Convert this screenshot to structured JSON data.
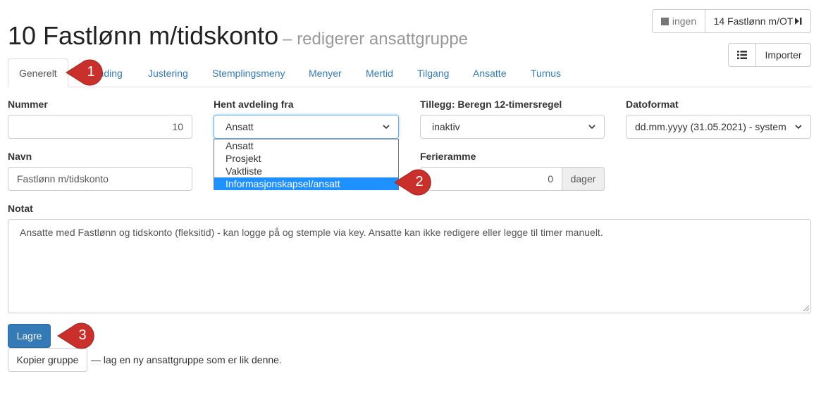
{
  "title": {
    "main": "10 Fastlønn m/tidskonto",
    "sub": "– redigerer ansattgruppe"
  },
  "topnav": {
    "prev_label": "ingen",
    "next_label": "14 Fastlønn m/OT"
  },
  "toolbar": {
    "import_label": "Importer"
  },
  "tabs": [
    {
      "label": "Generelt"
    },
    {
      "label": "Avrunding"
    },
    {
      "label": "Justering"
    },
    {
      "label": "Stemplingsmeny"
    },
    {
      "label": "Menyer"
    },
    {
      "label": "Mertid"
    },
    {
      "label": "Tilgang"
    },
    {
      "label": "Ansatte"
    },
    {
      "label": "Turnus"
    }
  ],
  "form": {
    "nummer": {
      "label": "Nummer",
      "value": "10"
    },
    "avdeling": {
      "label": "Hent avdeling fra",
      "value": "Ansatt",
      "options": [
        "Ansatt",
        "Prosjekt",
        "Vaktliste",
        "Informasjonskapsel/ansatt"
      ]
    },
    "tillegg": {
      "label": "Tillegg: Beregn 12-timersregel",
      "value": "inaktiv"
    },
    "datoformat": {
      "label": "Datoformat",
      "value": "dd.mm.yyyy (31.05.2021) - system"
    },
    "navn": {
      "label": "Navn",
      "value": "Fastlønn m/tidskonto"
    },
    "ferieramme": {
      "label": "Ferieramme",
      "value": "0",
      "unit": "dager"
    },
    "notat": {
      "label": "Notat",
      "value": "Ansatte med Fastlønn og tidskonto (fleksitid) - kan logge på og stemple via key. Ansatte kan ikke redigere eller legge til timer manuelt."
    }
  },
  "actions": {
    "save_label": "Lagre",
    "copy_label": "Kopier gruppe",
    "copy_hint": "— lag en ny ansattgruppe som er lik denne."
  },
  "markers": [
    "1",
    "2",
    "3"
  ],
  "colors": {
    "primary": "#337ab7",
    "link": "#337ab7",
    "marker": "#c9302c",
    "highlight": "#1e90ff"
  },
  "icons": {
    "stop": "stop-icon",
    "skip": "skip-forward-icon",
    "list": "list-icon",
    "chevron": "chevron-down-icon"
  }
}
